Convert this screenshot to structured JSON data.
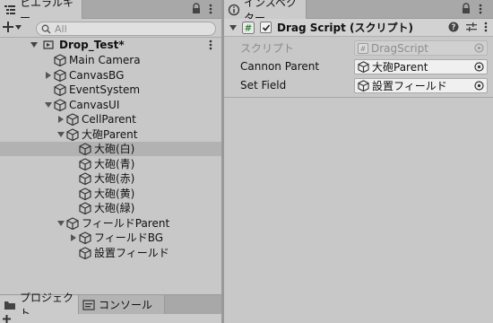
{
  "hierarchy": {
    "tab_label": "ヒエラルキー",
    "search_placeholder": "All",
    "scene_name": "Drop_Test*",
    "items": [
      {
        "label": "Main Camera"
      },
      {
        "label": "CanvasBG"
      },
      {
        "label": "EventSystem"
      },
      {
        "label": "CanvasUI"
      },
      {
        "label": "CellParent"
      },
      {
        "label": "大砲Parent"
      },
      {
        "label": "大砲(白)"
      },
      {
        "label": "大砲(青)"
      },
      {
        "label": "大砲(赤)"
      },
      {
        "label": "大砲(黄)"
      },
      {
        "label": "大砲(緑)"
      },
      {
        "label": "フィールドParent"
      },
      {
        "label": "フィールドBG"
      },
      {
        "label": "設置フィールド"
      }
    ]
  },
  "bottom_tabs": {
    "project": "プロジェクト",
    "console": "コンソール"
  },
  "inspector": {
    "tab_label": "インスペクター",
    "component": {
      "title": "Drag Script (スクリプト)",
      "enabled": true
    },
    "fields": [
      {
        "label": "スクリプト",
        "value": "DragScript",
        "disabled": true
      },
      {
        "label": "Cannon Parent",
        "value": "大砲Parent",
        "disabled": false
      },
      {
        "label": "Set Field",
        "value": "設置フィールド",
        "disabled": false
      }
    ]
  },
  "colors": {
    "panel_bg": "#c8c8c8",
    "tab_bg": "#a8a8a8",
    "selected_row": "#b2b2b2",
    "field_bg": "#f0f0f0"
  },
  "icons": [
    "hierarchy-icon",
    "lock-icon",
    "kebab-icon",
    "plus-icon",
    "search-icon",
    "unity-scene-icon",
    "gameobject-cube-icon",
    "project-folder-icon",
    "console-icon",
    "inspector-icon",
    "script-icon",
    "help-icon",
    "presets-icon",
    "object-picker-icon"
  ]
}
